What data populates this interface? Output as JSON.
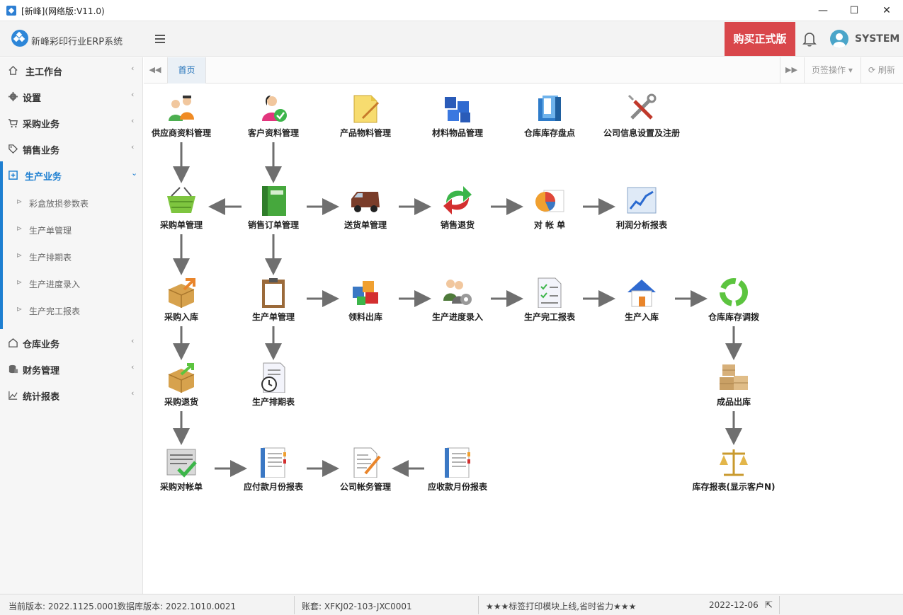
{
  "window": {
    "title": "[新峰](网络版:V11.0)",
    "minimize": "—",
    "maximize": "☐",
    "close": "✕"
  },
  "header": {
    "brand": "新峰彩印行业ERP系统",
    "buy_label": "购买正式版",
    "username": "SYSTEM"
  },
  "sidebar": {
    "items": [
      {
        "label": "主工作台",
        "icon": "home-icon"
      },
      {
        "label": "设置",
        "icon": "gear-icon"
      },
      {
        "label": "采购业务",
        "icon": "cart-icon"
      },
      {
        "label": "销售业务",
        "icon": "tag-icon"
      },
      {
        "label": "生产业务",
        "icon": "plus-square-icon",
        "active": true
      },
      {
        "label": "仓库业务",
        "icon": "warehouse-icon"
      },
      {
        "label": "财务管理",
        "icon": "database-icon"
      },
      {
        "label": "统计报表",
        "icon": "line-chart-icon"
      }
    ],
    "subitems": [
      {
        "label": "彩盒放损参数表"
      },
      {
        "label": "生产单管理"
      },
      {
        "label": "生产排期表"
      },
      {
        "label": "生产进度录入"
      },
      {
        "label": "生产完工报表"
      }
    ]
  },
  "tabs": {
    "home": "首页",
    "page_ops": "页签操作",
    "refresh": "刷新"
  },
  "flow": {
    "nodes": [
      {
        "label": "供应商资料管理",
        "icon": "suppliers-icon"
      },
      {
        "label": "客户资料管理",
        "icon": "customer-icon"
      },
      {
        "label": "产品物料管理",
        "icon": "notepad-icon"
      },
      {
        "label": "材料物品管理",
        "icon": "blocks-icon"
      },
      {
        "label": "仓库库存盘点",
        "icon": "binder-icon"
      },
      {
        "label": "公司信息设置及注册",
        "icon": "tools-icon"
      },
      {
        "label": "采购单管理",
        "icon": "basket-icon"
      },
      {
        "label": "销售订单管理",
        "icon": "green-book-icon"
      },
      {
        "label": "送货单管理",
        "icon": "van-icon"
      },
      {
        "label": "销售退货",
        "icon": "return-arrows-icon"
      },
      {
        "label": "对 帐 单",
        "icon": "pie-chart-icon"
      },
      {
        "label": "利润分析报表",
        "icon": "trend-chart-icon"
      },
      {
        "label": "采购入库",
        "icon": "box-in-icon"
      },
      {
        "label": "生产单管理",
        "icon": "clipboard-icon"
      },
      {
        "label": "领料出库",
        "icon": "puzzle-icon"
      },
      {
        "label": "生产进度录入",
        "icon": "people-gear-icon"
      },
      {
        "label": "生产完工报表",
        "icon": "checklist-icon"
      },
      {
        "label": "生产入库",
        "icon": "house-icon"
      },
      {
        "label": "仓库库存调拨",
        "icon": "recycle-icon"
      },
      {
        "label": "采购退货",
        "icon": "box-out-icon"
      },
      {
        "label": "生产排期表",
        "icon": "schedule-clock-icon"
      },
      {
        "label": "成品出库",
        "icon": "boxes-icon"
      },
      {
        "label": "采购对帐单",
        "icon": "ledger-check-icon"
      },
      {
        "label": "应付款月份报表",
        "icon": "notebook-icon"
      },
      {
        "label": "公司帐务管理",
        "icon": "document-pen-icon"
      },
      {
        "label": "应收款月份报表",
        "icon": "notebook-icon"
      },
      {
        "label": "库存报表(显示客户N)",
        "icon": "scales-icon"
      }
    ]
  },
  "status": {
    "version": "当前版本: 2022.1125.0001",
    "db_version": "数据库版本: 2022.1010.0021",
    "account": "账套: XFKJ02-103-JXC0001",
    "notice": "★★★标签打印模块上线,省时省力★★★",
    "date": "2022-12-06"
  },
  "colors": {
    "accent": "#1e7fd1",
    "buy": "#d9474b",
    "arrow": "#6f6f6f"
  }
}
